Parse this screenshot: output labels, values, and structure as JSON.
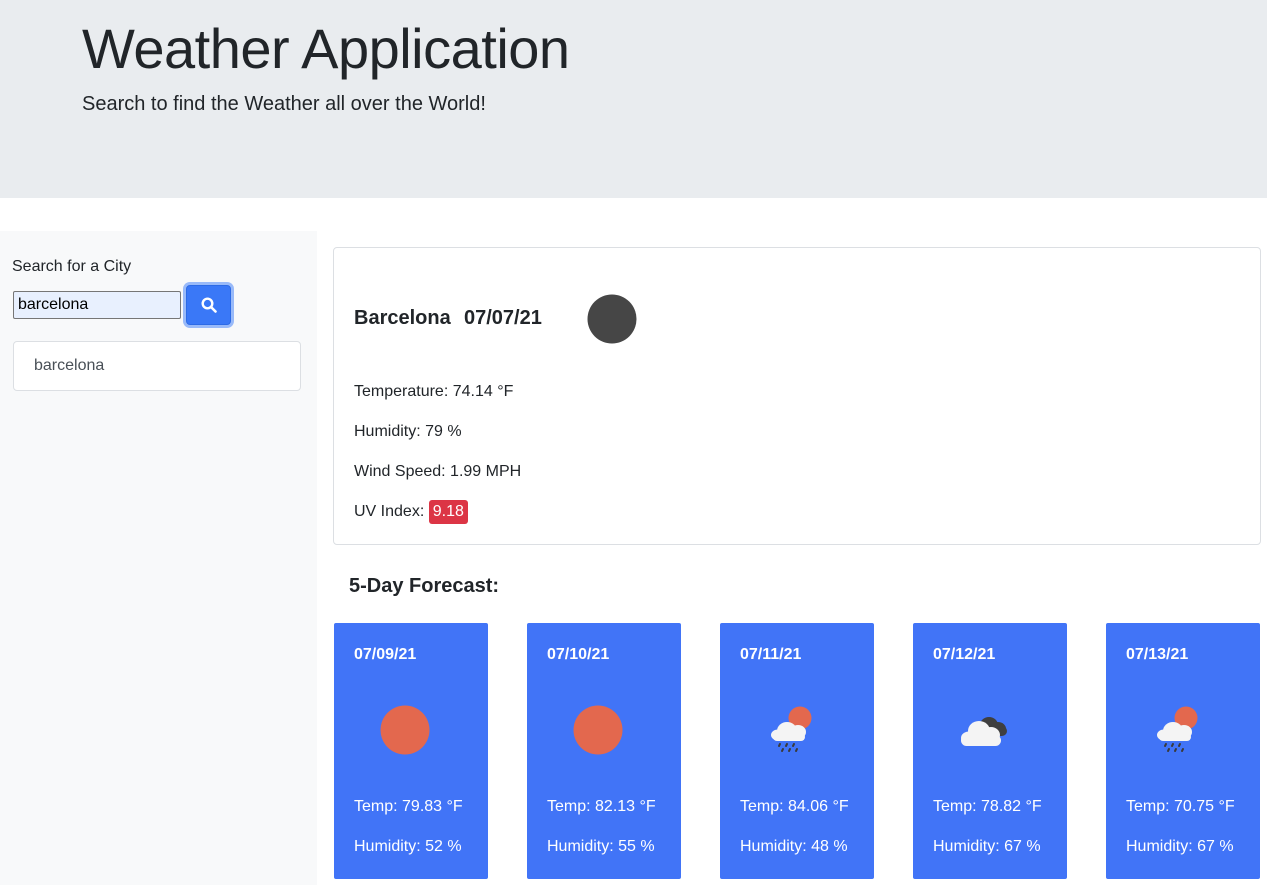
{
  "header": {
    "title": "Weather Application",
    "subtitle": "Search to find the Weather all over the World!"
  },
  "search": {
    "label": "Search for a City",
    "value": "barcelona",
    "button_icon": "search-icon"
  },
  "history": [
    {
      "label": "barcelona"
    }
  ],
  "current": {
    "city": "Barcelona",
    "date": "07/07/21",
    "icon": "clear-night-moon-icon",
    "temperature": "Temperature: 74.14 °F",
    "humidity": "Humidity: 79 %",
    "wind": "Wind Speed: 1.99 MPH",
    "uv_label": "UV Index:",
    "uv_value": "9.18",
    "uv_color": "#dc3545"
  },
  "forecast": {
    "title": "5-Day Forecast:",
    "card_color": "#4174f7",
    "days": [
      {
        "date": "07/09/21",
        "icon": "sun-icon",
        "temp": "Temp: 79.83 °F",
        "humidity": "Humidity: 52 %"
      },
      {
        "date": "07/10/21",
        "icon": "sun-icon",
        "temp": "Temp: 82.13 °F",
        "humidity": "Humidity: 55 %"
      },
      {
        "date": "07/11/21",
        "icon": "rain-sun-icon",
        "temp": "Temp: 84.06 °F",
        "humidity": "Humidity: 48 %"
      },
      {
        "date": "07/12/21",
        "icon": "broken-clouds-icon",
        "temp": "Temp: 78.82 °F",
        "humidity": "Humidity: 67 %"
      },
      {
        "date": "07/13/21",
        "icon": "rain-sun-icon",
        "temp": "Temp: 70.75 °F",
        "humidity": "Humidity: 67 %"
      }
    ]
  }
}
